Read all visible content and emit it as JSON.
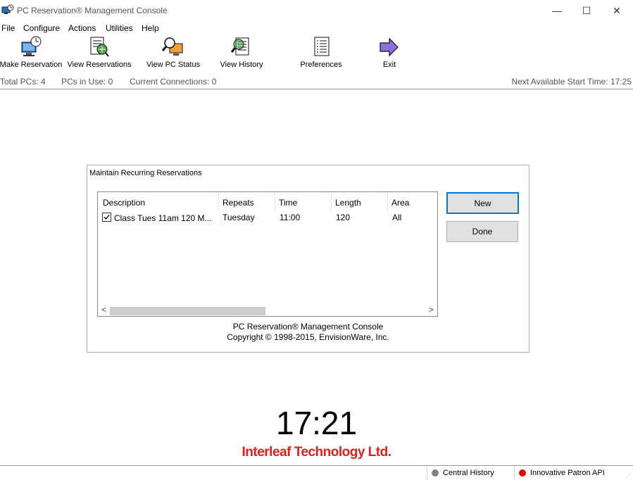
{
  "window": {
    "title": "PC Reservation® Management Console",
    "min_glyph": "—",
    "max_glyph": "☐",
    "close_glyph": "✕"
  },
  "menu": [
    "File",
    "Configure",
    "Actions",
    "Utilities",
    "Help"
  ],
  "toolbar": [
    {
      "label": "Make Reservation",
      "icon": "make-reservation-icon"
    },
    {
      "label": "View Reservations",
      "icon": "view-reservations-icon"
    },
    {
      "label": "View PC Status",
      "icon": "view-pc-status-icon"
    },
    {
      "label": "View History",
      "icon": "view-history-icon"
    },
    {
      "label": "Preferences",
      "icon": "preferences-icon"
    },
    {
      "label": "Exit",
      "icon": "exit-icon"
    }
  ],
  "status": {
    "total_pcs": "Total PCs: 4",
    "pcs_in_use": "PCs in Use: 0",
    "connections": "Current Connections: 0",
    "next_available": "Next Available Start Time: 17:25"
  },
  "dialog": {
    "title": "Maintain Recurring Reservations",
    "columns": [
      "Description",
      "Repeats",
      "Time",
      "Length",
      "Area"
    ],
    "rows": [
      {
        "checked": true,
        "description": "Class Tues 11am 120 M...",
        "repeats": "Tuesday",
        "time": "11:00",
        "length": "120",
        "area": "All"
      }
    ],
    "new_label": "New",
    "done_label": "Done",
    "footer_line1": "PC Reservation® Management Console",
    "footer_line2": "Copyright © 1998-2015, EnvisionWare, Inc."
  },
  "clock": "17:21",
  "company": "Interleaf Technology Ltd.",
  "bottom": {
    "central_history": "Central History",
    "central_history_color": "#808080",
    "patron_api": "Innovative Patron API",
    "patron_api_color": "#e00000"
  },
  "colors": {
    "accent": "#0078d7",
    "brand_red": "#e41d1d"
  }
}
